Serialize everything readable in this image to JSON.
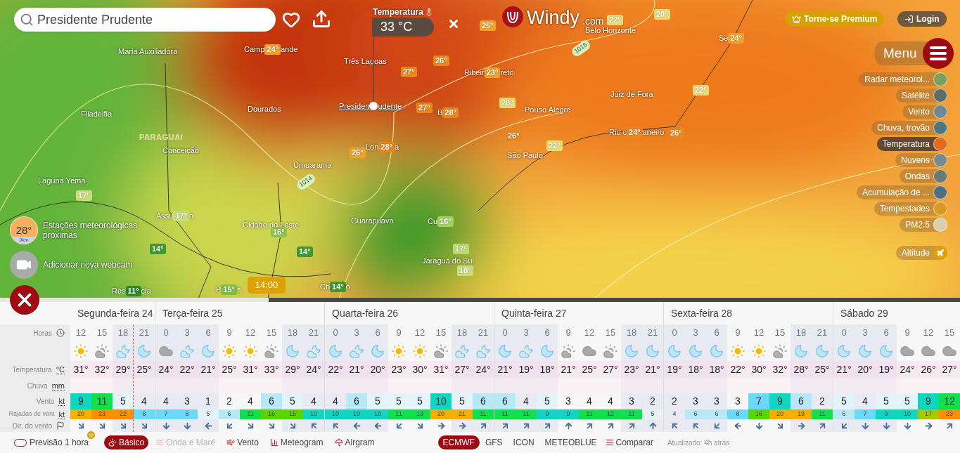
{
  "search": {
    "value": "Presidente Prudente"
  },
  "readout": {
    "title": "Temperatura",
    "value": "33 °C"
  },
  "logo": {
    "name": "Windy",
    "suffix": ".com"
  },
  "account": {
    "premium": "Torne-se Premium",
    "login": "Login"
  },
  "menu": {
    "label": "Menu"
  },
  "layers": [
    {
      "label": "Radar meteorol...",
      "kind": "layer",
      "selected": false
    },
    {
      "label": "Satélite",
      "kind": "layer",
      "selected": false
    },
    {
      "label": "Vento",
      "kind": "layer",
      "selected": false
    },
    {
      "label": "Chuva, trovão",
      "kind": "layer",
      "selected": false
    },
    {
      "label": "Temperatura",
      "kind": "layer",
      "selected": true
    },
    {
      "label": "Nuvens",
      "kind": "layer",
      "selected": false
    },
    {
      "label": "Ondas",
      "kind": "layer",
      "selected": false
    },
    {
      "label": "Acumulação de ...",
      "kind": "layer",
      "selected": false
    },
    {
      "label": "Tempestades",
      "kind": "layer",
      "selected": false
    },
    {
      "label": "PM2.5",
      "kind": "layer",
      "selected": false
    },
    {
      "label": "Altitude",
      "kind": "altitude",
      "selected": false
    }
  ],
  "places": [
    {
      "kind": "pin",
      "text": "25°",
      "color": "#f0a22a"
    },
    {
      "kind": "city",
      "text": "Belo Horizonte"
    },
    {
      "kind": "pin",
      "text": "22°",
      "color": "#e8dc78"
    },
    {
      "kind": "pin",
      "text": "20°",
      "color": "#e8dc78"
    },
    {
      "kind": "pin",
      "text": "24°",
      "before": "Se",
      "color": "#f0a22a"
    },
    {
      "kind": "city",
      "text": "Maria Auxiliadora"
    },
    {
      "kind": "pin",
      "text": "24°",
      "before": "Camp",
      "after": "ande",
      "color": "#f0a22a"
    },
    {
      "kind": "isobar",
      "text": "1016"
    },
    {
      "kind": "city",
      "text": "Três Lagoas"
    },
    {
      "kind": "pin",
      "text": "26°",
      "color": "#e8871e"
    },
    {
      "kind": "pin",
      "text": "27°",
      "color": "#e8871e"
    },
    {
      "kind": "pin",
      "text": "23°",
      "before": "Ribeir",
      "after": "reto",
      "color": "#f0a22a"
    },
    {
      "kind": "city",
      "text": "Juiz de Fora"
    },
    {
      "kind": "pin",
      "text": "22°",
      "color": "#e8dc78"
    },
    {
      "kind": "city",
      "text": "Filadelfia"
    },
    {
      "kind": "city",
      "text": "Dourados"
    },
    {
      "kind": "selected",
      "before": "Presiden",
      "after": "udente"
    },
    {
      "kind": "pin",
      "text": "27°",
      "color": "#e8871e"
    },
    {
      "kind": "pin",
      "text": "28°",
      "before": "B",
      "color": "#e8871e"
    },
    {
      "kind": "pin",
      "text": "20°",
      "color": "#e8dc78"
    },
    {
      "kind": "city",
      "text": "Pouso Alegre"
    },
    {
      "kind": "country",
      "text": "PARAGUAI"
    },
    {
      "kind": "pin",
      "text": "26°",
      "color": "#e8871e"
    },
    {
      "kind": "pin",
      "text": "24°",
      "before": "Rio c",
      "after": "aneiro",
      "color": "#e8871e"
    },
    {
      "kind": "pin",
      "text": "26°",
      "color": "#e8871e"
    },
    {
      "kind": "city",
      "text": "Conceição"
    },
    {
      "kind": "pin",
      "text": "26°",
      "color": "#f0a22a"
    },
    {
      "kind": "pin",
      "text": "28°",
      "before": "Lon",
      "after": "a",
      "color": "#e8871e"
    },
    {
      "kind": "city",
      "text": "São Paulo"
    },
    {
      "kind": "pin",
      "text": "22°",
      "color": "#e8dc78"
    },
    {
      "kind": "city",
      "text": "Umuarama"
    },
    {
      "kind": "city",
      "text": "Laguna Yema"
    },
    {
      "kind": "isobar",
      "text": "1014"
    },
    {
      "kind": "pin",
      "text": "17°",
      "color": "#c8de7a"
    },
    {
      "kind": "pin",
      "text": "17°",
      "before": "Assu",
      "after": "o",
      "color": "#c8de7a"
    },
    {
      "kind": "city",
      "text": "Cidade do Leste"
    },
    {
      "kind": "city",
      "text": "Guarapuava"
    },
    {
      "kind": "pin",
      "text": "16°",
      "before": "Cu",
      "color": "#a6d060"
    },
    {
      "kind": "pin",
      "text": "16°",
      "color": "#8cc54a"
    },
    {
      "kind": "pin",
      "text": "14°",
      "color": "#3d9b2c"
    },
    {
      "kind": "pin",
      "text": "14°",
      "color": "#3d9b2c"
    },
    {
      "kind": "pin",
      "text": "17°",
      "color": "#b8dc70"
    },
    {
      "kind": "city",
      "text": "Jaraguá do Sul"
    },
    {
      "kind": "pin",
      "text": "18°",
      "color": "#c8de7a"
    },
    {
      "kind": "pin",
      "text": "11°",
      "before": "Res",
      "after": "cia",
      "color": "#2e8a2a"
    },
    {
      "kind": "pin",
      "text": "15°",
      "before": "P",
      "after": "s",
      "color": "#7fbf45"
    },
    {
      "kind": "pin",
      "text": "14°",
      "before": "Ch",
      "after": "ó",
      "color": "#3d9b2c"
    }
  ],
  "stations": {
    "temp": "28°",
    "distance": "0km",
    "label": "Estações meteorológicas próximas"
  },
  "webcam": {
    "label": "Adicionar nova webcam"
  },
  "timeline": {
    "level": 0.28,
    "time": "14:00"
  },
  "forecast": {
    "row_labels": [
      {
        "kind": "hours",
        "label": "Horas"
      },
      {
        "kind": "icon"
      },
      {
        "kind": "temp",
        "label": "Temperatura",
        "unit": "°C"
      },
      {
        "kind": "rain",
        "label": "Chuva",
        "unit": "mm"
      },
      {
        "kind": "wind",
        "label": "Vento",
        "unit": "kt"
      },
      {
        "kind": "gust",
        "label": "Rajadas de vent",
        "unit": "kt"
      },
      {
        "kind": "dir",
        "label": "Dir. do vento"
      }
    ],
    "days": [
      {
        "label": "Segunda-feira 24",
        "hours": [
          {
            "hour": "12",
            "kind": "sun",
            "temp": "31°",
            "wind": "9",
            "gust": "20",
            "arrow": {
              "kind": "SE"
            },
            "night": false
          },
          {
            "hour": "15",
            "kind": "sun-cloud",
            "temp": "32°",
            "wind": "11",
            "gust": "23",
            "arrow": {
              "kind": "SE"
            },
            "night": false
          },
          {
            "hour": "18",
            "kind": "moon-cloud",
            "temp": "29°",
            "wind": "5",
            "gust": "22",
            "arrow": {
              "kind": "SE"
            },
            "night": true
          },
          {
            "hour": "21",
            "kind": "moon",
            "temp": "25°",
            "wind": "4",
            "gust": "8",
            "arrow": {
              "kind": "SE"
            },
            "night": true
          }
        ]
      },
      {
        "label": "Terça-feira 25",
        "hours": [
          {
            "hour": "0",
            "kind": "cloud",
            "temp": "24°",
            "wind": "4",
            "gust": "7",
            "arrow": {
              "kind": "S"
            },
            "night": true
          },
          {
            "hour": "3",
            "kind": "moon-cloud",
            "temp": "22°",
            "wind": "3",
            "gust": "8",
            "arrow": {
              "kind": "S"
            },
            "night": true
          },
          {
            "hour": "6",
            "kind": "moon",
            "temp": "21°",
            "wind": "1",
            "gust": "5",
            "arrow": {
              "kind": "W"
            },
            "night": true
          },
          {
            "hour": "9",
            "kind": "sun",
            "temp": "25°",
            "wind": "2",
            "gust": "6",
            "arrow": {
              "kind": "SW"
            },
            "night": false
          },
          {
            "hour": "12",
            "kind": "sun",
            "temp": "31°",
            "wind": "4",
            "gust": "11",
            "arrow": {
              "kind": "SE"
            },
            "night": false
          },
          {
            "hour": "15",
            "kind": "sun-cloud",
            "temp": "33°",
            "wind": "6",
            "gust": "16",
            "arrow": {
              "kind": "SE"
            },
            "night": false
          },
          {
            "hour": "18",
            "kind": "moon",
            "temp": "29°",
            "wind": "5",
            "gust": "15",
            "arrow": {
              "kind": "SE"
            },
            "night": true
          },
          {
            "hour": "21",
            "kind": "moon-cloud",
            "temp": "24°",
            "wind": "4",
            "gust": "10",
            "arrow": {
              "kind": "NW"
            },
            "night": true
          }
        ]
      },
      {
        "label": "Quarta-feira 26",
        "hours": [
          {
            "hour": "0",
            "kind": "moon",
            "temp": "22°",
            "wind": "4",
            "gust": "10",
            "arrow": {
              "kind": "NW"
            },
            "night": true
          },
          {
            "hour": "3",
            "kind": "moon-cloud",
            "temp": "21°",
            "wind": "6",
            "gust": "10",
            "arrow": {
              "kind": "W"
            },
            "night": true
          },
          {
            "hour": "6",
            "kind": "moon",
            "temp": "20°",
            "wind": "5",
            "gust": "10",
            "arrow": {
              "kind": "W"
            },
            "night": true
          },
          {
            "hour": "9",
            "kind": "sun",
            "temp": "23°",
            "wind": "5",
            "gust": "11",
            "arrow": {
              "kind": "SW"
            },
            "night": false
          },
          {
            "hour": "12",
            "kind": "sun",
            "temp": "30°",
            "wind": "5",
            "gust": "13",
            "arrow": {
              "kind": "SE"
            },
            "night": false
          },
          {
            "hour": "15",
            "kind": "sun-cloud",
            "temp": "31°",
            "wind": "10",
            "gust": "20",
            "arrow": {
              "kind": "E"
            },
            "night": false
          },
          {
            "hour": "18",
            "kind": "moon-cloud",
            "temp": "27°",
            "wind": "5",
            "gust": "21",
            "arrow": {
              "kind": "E"
            },
            "night": true
          },
          {
            "hour": "21",
            "kind": "moon-cloud",
            "temp": "24°",
            "wind": "6",
            "gust": "11",
            "arrow": {
              "kind": "NE"
            },
            "night": true
          }
        ]
      },
      {
        "label": "Quinta-feira 27",
        "hours": [
          {
            "hour": "0",
            "kind": "moon",
            "temp": "21°",
            "wind": "6",
            "gust": "11",
            "arrow": {
              "kind": "NE"
            },
            "night": true
          },
          {
            "hour": "3",
            "kind": "moon-cloud",
            "temp": "19°",
            "wind": "4",
            "gust": "11",
            "arrow": {
              "kind": "NE"
            },
            "night": true
          },
          {
            "hour": "6",
            "kind": "moon",
            "temp": "18°",
            "wind": "5",
            "gust": "9",
            "arrow": {
              "kind": "NE"
            },
            "night": true
          },
          {
            "hour": "9",
            "kind": "sun-cloud",
            "temp": "21°",
            "wind": "3",
            "gust": "9",
            "arrow": {
              "kind": "N"
            },
            "night": false
          },
          {
            "hour": "12",
            "kind": "cloud",
            "temp": "25°",
            "wind": "4",
            "gust": "11",
            "arrow": {
              "kind": "NE"
            },
            "night": false
          },
          {
            "hour": "15",
            "kind": "sun-cloud",
            "temp": "27°",
            "wind": "4",
            "gust": "12",
            "arrow": {
              "kind": "NE"
            },
            "night": false
          },
          {
            "hour": "18",
            "kind": "moon",
            "temp": "23°",
            "wind": "3",
            "gust": "11",
            "arrow": {
              "kind": "NE"
            },
            "night": true
          },
          {
            "hour": "21",
            "kind": "moon",
            "temp": "21°",
            "wind": "2",
            "gust": "5",
            "arrow": {
              "kind": "N"
            },
            "night": true
          }
        ]
      },
      {
        "label": "Sexta-feira 28",
        "hours": [
          {
            "hour": "0",
            "kind": "moon",
            "temp": "19°",
            "wind": "2",
            "gust": "4",
            "arrow": {
              "kind": "NW"
            },
            "night": true
          },
          {
            "hour": "3",
            "kind": "moon",
            "temp": "18°",
            "wind": "3",
            "gust": "6",
            "arrow": {
              "kind": "NW"
            },
            "night": true
          },
          {
            "hour": "6",
            "kind": "moon",
            "temp": "18°",
            "wind": "3",
            "gust": "6",
            "arrow": {
              "kind": "SW"
            },
            "night": true
          },
          {
            "hour": "9",
            "kind": "sun",
            "temp": "22°",
            "wind": "3",
            "gust": "8",
            "arrow": {
              "kind": "W"
            },
            "night": false
          },
          {
            "hour": "12",
            "kind": "sun",
            "temp": "30°",
            "wind": "7",
            "gust": "16",
            "arrow": {
              "kind": "S"
            },
            "night": false
          },
          {
            "hour": "15",
            "kind": "sun-cloud",
            "temp": "32°",
            "wind": "9",
            "gust": "20",
            "arrow": {
              "kind": "SE"
            },
            "night": false
          },
          {
            "hour": "18",
            "kind": "moon",
            "temp": "28°",
            "wind": "6",
            "gust": "19",
            "arrow": {
              "kind": "E"
            },
            "night": true
          },
          {
            "hour": "21",
            "kind": "moon",
            "temp": "25°",
            "wind": "2",
            "gust": "11",
            "arrow": {
              "kind": "NE"
            },
            "night": true
          }
        ]
      },
      {
        "label": "Sábado 29",
        "hours": [
          {
            "hour": "0",
            "kind": "moon",
            "temp": "21°",
            "wind": "5",
            "gust": "6",
            "arrow": {
              "kind": "SW"
            },
            "night": true
          },
          {
            "hour": "3",
            "kind": "moon",
            "temp": "20°",
            "wind": "4",
            "gust": "7",
            "arrow": {
              "kind": "S"
            },
            "night": true
          },
          {
            "hour": "6",
            "kind": "moon",
            "temp": "19°",
            "wind": "5",
            "gust": "9",
            "arrow": {
              "kind": "S"
            },
            "night": true
          },
          {
            "hour": "9",
            "kind": "cloud",
            "temp": "24°",
            "wind": "5",
            "gust": "10",
            "arrow": {
              "kind": "S"
            },
            "night": false
          },
          {
            "hour": "12",
            "kind": "cloud",
            "temp": "26°",
            "wind": "9",
            "gust": "17",
            "arrow": {
              "kind": "E"
            },
            "night": false
          },
          {
            "hour": "15",
            "kind": "cloud",
            "temp": "27°",
            "wind": "12",
            "gust": "23",
            "arrow": {
              "kind": "NE"
            },
            "night": false
          }
        ]
      }
    ]
  },
  "bottom": {
    "option": {
      "label": "Previsão 1 hora",
      "on": false,
      "premium": true
    },
    "views": [
      {
        "label": "Básico",
        "kind": "basic",
        "selected": true,
        "disabled": false
      },
      {
        "label": "Onda e Maré",
        "kind": "waves",
        "selected": false,
        "disabled": true
      },
      {
        "label": "Vento",
        "kind": "wind",
        "selected": false,
        "disabled": false
      },
      {
        "label": "Meteogram",
        "kind": "meteogram",
        "selected": false,
        "disabled": false
      },
      {
        "label": "Airgram",
        "kind": "airgram",
        "selected": false,
        "disabled": false
      }
    ],
    "models": [
      {
        "label": "ECMWF",
        "selected": true
      },
      {
        "label": "GFS",
        "selected": false
      },
      {
        "label": "ICON",
        "selected": false
      },
      {
        "label": "METEOBLUE",
        "selected": false
      }
    ],
    "compare": "Comparar",
    "updated": "Atualizado: 4h atrás"
  }
}
